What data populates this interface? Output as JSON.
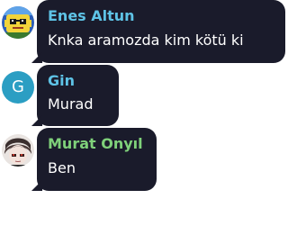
{
  "messages": [
    {
      "sender": "Enes Altun",
      "name_color": "#5ec3e6",
      "text": "Knka aramozda kim kötü ki",
      "avatar": {
        "type": "image",
        "icon": "pixel-art-avatar-icon"
      }
    },
    {
      "sender": "Gin",
      "name_color": "#5ec3e6",
      "text": "Murad",
      "avatar": {
        "type": "letter",
        "letter": "G",
        "color": "#2b9ec3"
      }
    },
    {
      "sender": "Murat Onyıl",
      "name_color": "#7fd17a",
      "text": "Ben",
      "avatar": {
        "type": "image",
        "icon": "anime-character-avatar-icon"
      }
    }
  ],
  "colors": {
    "bubble_background": "#1a1b2b",
    "message_text": "#ffffff",
    "page_background": "#ffffff"
  }
}
